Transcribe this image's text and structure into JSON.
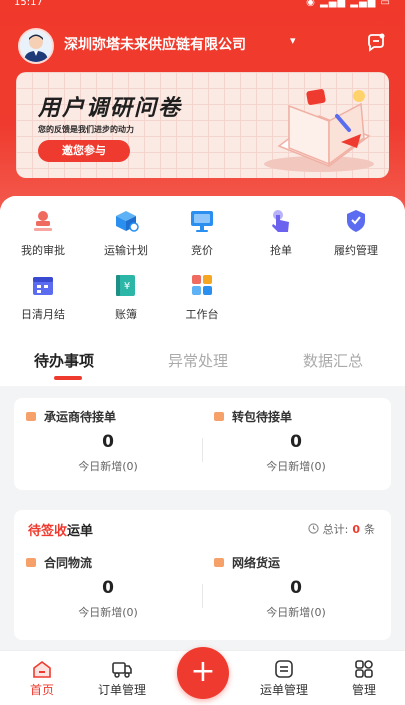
{
  "status_bar": {
    "time": "15:17",
    "system_icons": "◉ ▂▄▆ ▂▄▆ ▭"
  },
  "header": {
    "company": "深圳弥塔未来供应链有限公司",
    "caret": "▾"
  },
  "banner": {
    "title": "用户调研问卷",
    "subtitle": "您的反馈是我们进步的动力",
    "button": "邀您参与"
  },
  "menu": [
    {
      "label": "我的审批",
      "icon": "stamp-icon",
      "color": "#ef6b5f"
    },
    {
      "label": "运输计划",
      "icon": "cube-plan-icon",
      "color": "#2b8ff0"
    },
    {
      "label": "竞价",
      "icon": "monitor-icon",
      "color": "#2b8ff0"
    },
    {
      "label": "抢单",
      "icon": "tap-icon",
      "color": "#6b63f0"
    },
    {
      "label": "履约管理",
      "icon": "shield-icon",
      "color": "#5b6cf0"
    },
    {
      "label": "日清月结",
      "icon": "calendar-icon",
      "color": "#5b6cf0"
    },
    {
      "label": "账簿",
      "icon": "ledger-icon",
      "color": "#2bb6a8"
    },
    {
      "label": "工作台",
      "icon": "grid-icon",
      "color": "#ef6b5f"
    }
  ],
  "tabs": [
    "待办事项",
    "异常处理",
    "数据汇总"
  ],
  "card1": {
    "items": [
      {
        "head": "承运商待接单",
        "value": "0",
        "sub": "今日新增(0)"
      },
      {
        "head": "转包待接单",
        "value": "0",
        "sub": "今日新增(0)"
      }
    ]
  },
  "card2": {
    "title_red": "待签收",
    "title_rest": "运单",
    "total_label": "总计:",
    "total_value": "0",
    "total_unit": "条",
    "items": [
      {
        "head": "合同物流",
        "value": "0",
        "sub": "今日新增(0)"
      },
      {
        "head": "网络货运",
        "value": "0",
        "sub": "今日新增(0)"
      }
    ]
  },
  "tabbar": {
    "items": [
      {
        "label": "首页",
        "icon": "home-icon"
      },
      {
        "label": "订单管理",
        "icon": "truck-icon"
      },
      {
        "label": "运单管理",
        "icon": "waybill-icon"
      },
      {
        "label": "管理",
        "icon": "apps-icon"
      }
    ],
    "plus": "+"
  },
  "colors": {
    "accent": "#ef3b2f",
    "banner_bg": "#fbe9e4"
  }
}
